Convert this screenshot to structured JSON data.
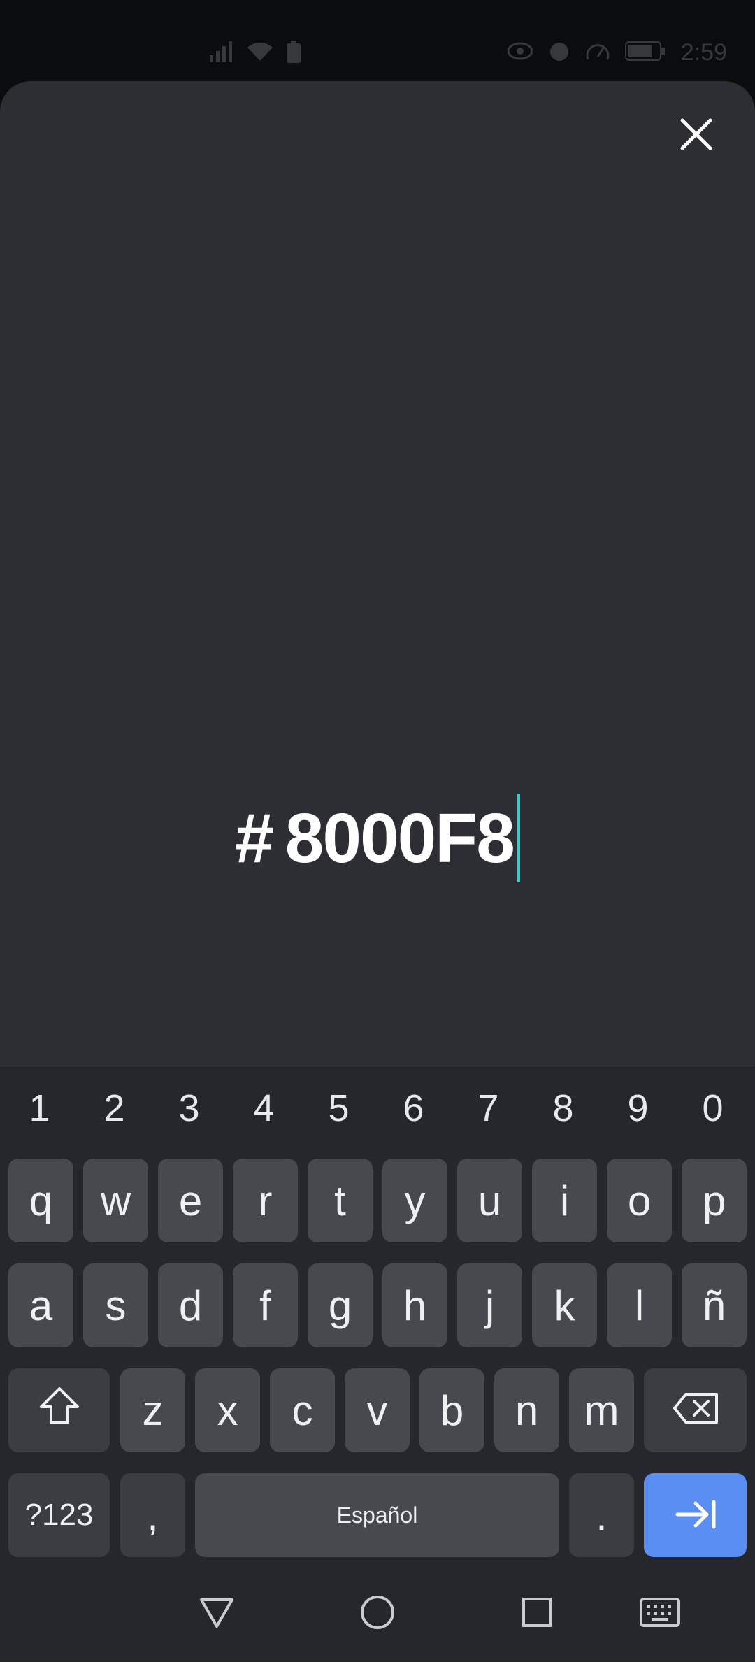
{
  "status_bar": {
    "time": "2:59",
    "icons": [
      "signal-icon",
      "wifi-icon",
      "battery-saver-icon",
      "eye-icon",
      "alarm-icon",
      "speed-icon",
      "battery-icon"
    ]
  },
  "sheet": {
    "close_icon": "close-icon",
    "hex_hash": "#",
    "hex_value": "8000F8",
    "caret_color": "#2ad3c9"
  },
  "keyboard": {
    "number_row": [
      "1",
      "2",
      "3",
      "4",
      "5",
      "6",
      "7",
      "8",
      "9",
      "0"
    ],
    "row1": [
      "q",
      "w",
      "e",
      "r",
      "t",
      "y",
      "u",
      "i",
      "o",
      "p"
    ],
    "row2": [
      "a",
      "s",
      "d",
      "f",
      "g",
      "h",
      "j",
      "k",
      "l",
      "ñ"
    ],
    "row3": [
      "z",
      "x",
      "c",
      "v",
      "b",
      "n",
      "m"
    ],
    "symbols_label": "?123",
    "comma_label": ",",
    "space_label": "Español",
    "period_label": ".",
    "shift_icon": "shift-icon",
    "backspace_icon": "backspace-icon",
    "enter_icon": "tab-next-icon",
    "accent_color": "#5a8ef3"
  },
  "navbar": {
    "back_icon": "back-triangle-icon",
    "home_icon": "home-circle-icon",
    "recents_icon": "recents-square-icon",
    "keyboard_icon": "keyboard-icon"
  }
}
